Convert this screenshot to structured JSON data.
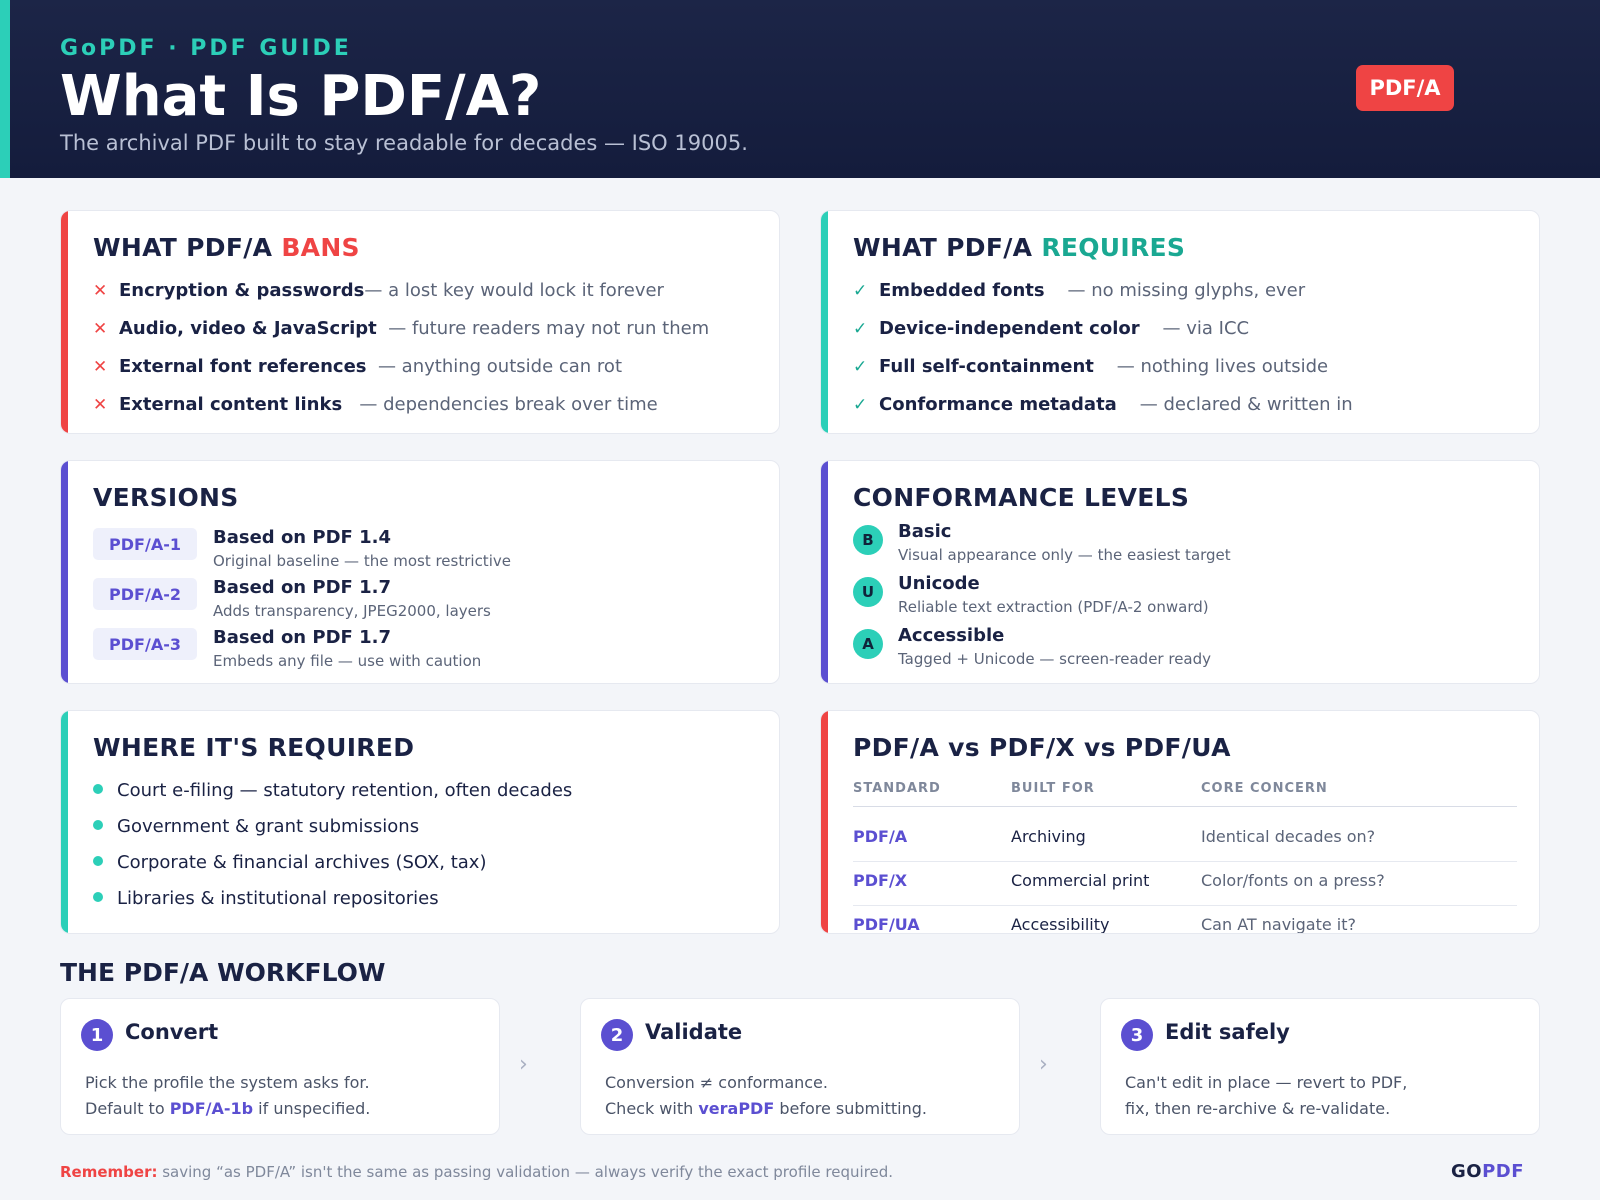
{
  "header": {
    "brand_line": "GoPDF · PDF GUIDE",
    "title": "What Is PDF/A?",
    "subtitle": "The archival PDF built to stay readable for decades — ISO 19005.",
    "badge": "PDF/A"
  },
  "bans": {
    "title_prefix": "WHAT PDF/A ",
    "title_accent": "BANS",
    "mark": "✕",
    "items": [
      {
        "label": "Encryption & passwords",
        "note": "— a lost key would lock it forever"
      },
      {
        "label": "Audio, video & JavaScript",
        "note": "— future readers may not run them"
      },
      {
        "label": "External font references",
        "note": "— anything outside can rot"
      },
      {
        "label": "External content links",
        "note": "— dependencies break over time"
      }
    ]
  },
  "requires": {
    "title_prefix": "WHAT PDF/A ",
    "title_accent": "REQUIRES",
    "mark": "✓",
    "items": [
      {
        "label": "Embedded fonts",
        "note": "— no missing glyphs, ever"
      },
      {
        "label": "Device-independent color",
        "note": "— via ICC"
      },
      {
        "label": "Full self-containment",
        "note": "— nothing lives outside"
      },
      {
        "label": "Conformance metadata",
        "note": "— declared & written in"
      }
    ]
  },
  "versions": {
    "title": "VERSIONS",
    "items": [
      {
        "tag": "PDF/A-1",
        "title": "Based on PDF 1.4",
        "desc": "Original baseline — the most restrictive"
      },
      {
        "tag": "PDF/A-2",
        "title": "Based on PDF 1.7",
        "desc": "Adds transparency, JPEG2000, layers"
      },
      {
        "tag": "PDF/A-3",
        "title": "Based on PDF 1.7",
        "desc": "Embeds any file — use with caution"
      }
    ]
  },
  "conformance": {
    "title": "CONFORMANCE LEVELS",
    "items": [
      {
        "letter": "B",
        "title": "Basic",
        "desc": "Visual appearance only — the easiest target"
      },
      {
        "letter": "U",
        "title": "Unicode",
        "desc": "Reliable text extraction (PDF/A-2 onward)"
      },
      {
        "letter": "A",
        "title": "Accessible",
        "desc": "Tagged + Unicode — screen-reader ready"
      }
    ]
  },
  "where_required": {
    "title": "WHERE IT'S REQUIRED",
    "items": [
      "Court e-filing — statutory retention, often decades",
      "Government & grant submissions",
      "Corporate & financial archives (SOX, tax)",
      "Libraries & institutional repositories"
    ]
  },
  "comparison": {
    "title": "PDF/A vs PDF/X vs PDF/UA",
    "headers": [
      "STANDARD",
      "BUILT FOR",
      "CORE CONCERN"
    ],
    "rows": [
      [
        "PDF/A",
        "Archiving",
        "Identical decades on?"
      ],
      [
        "PDF/X",
        "Commercial print",
        "Color/fonts on a press?"
      ],
      [
        "PDF/UA",
        "Accessibility",
        "Can AT navigate it?"
      ]
    ]
  },
  "workflow": {
    "title": "THE PDF/A WORKFLOW",
    "steps": [
      {
        "num": "1",
        "title": "Convert",
        "line1": "Pick the profile the system asks for.",
        "line2_pre": "Default to ",
        "line2_em": "PDF/A-1b",
        "line2_post": " if unspecified."
      },
      {
        "num": "2",
        "title": "Validate",
        "line1": "Conversion ≠ conformance.",
        "line2_pre": "Check with ",
        "line2_em": "veraPDF",
        "line2_post": " before submitting."
      },
      {
        "num": "3",
        "title": "Edit safely",
        "line1": "Can't edit in place — revert to PDF,",
        "line2_pre": "fix, then re-archive & re-validate.",
        "line2_em": "",
        "line2_post": ""
      }
    ],
    "chevron": "›"
  },
  "footer": {
    "remember_label": "Remember:",
    "note": " saving “as PDF/A” isn't the same as passing validation — always verify the exact profile required.",
    "logo_go": "GO",
    "logo_pdf": "PDF"
  },
  "colors": {
    "navy": "#1a2244",
    "teal": "#2ccfb8",
    "red": "#ef4444",
    "purple": "#5b4fd1"
  }
}
